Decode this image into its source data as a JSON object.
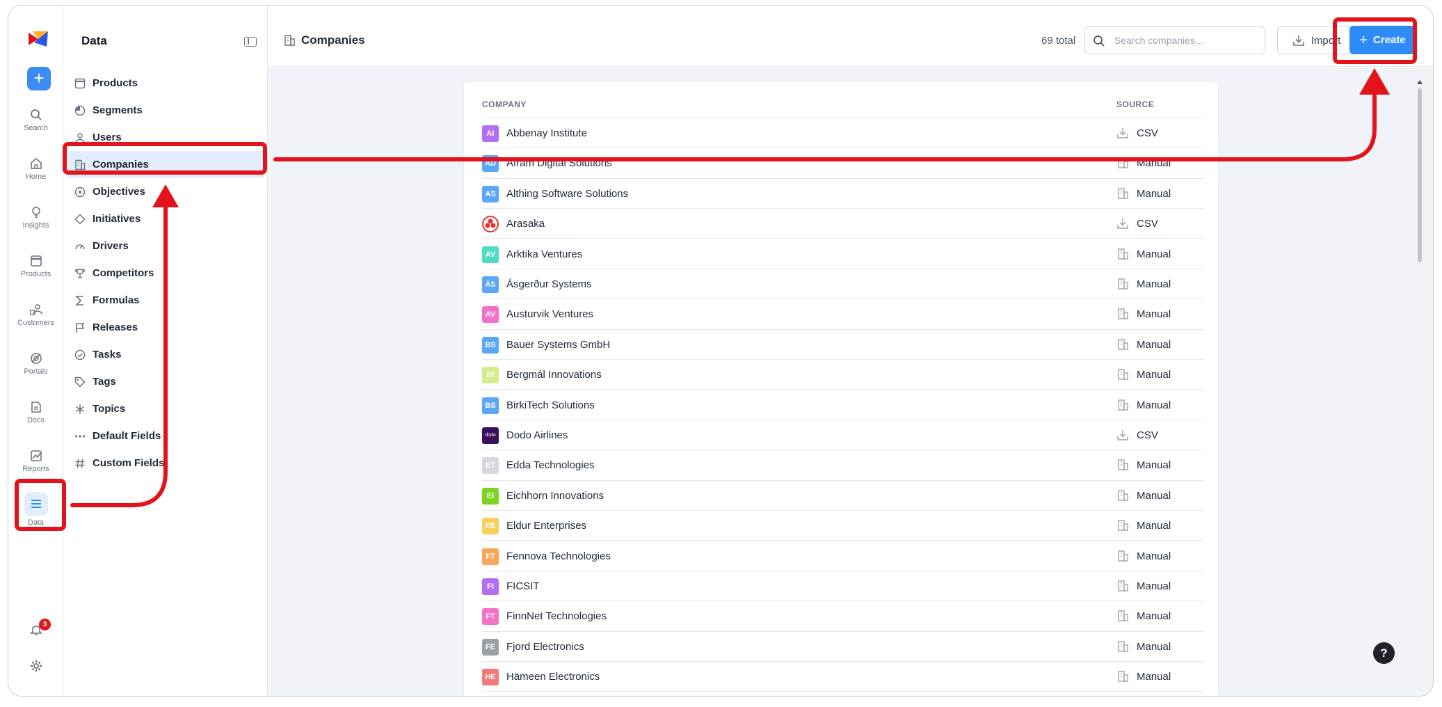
{
  "rail": {
    "items": [
      {
        "label": "Search",
        "icon": "search-icon"
      },
      {
        "label": "Home",
        "icon": "home-icon"
      },
      {
        "label": "Insights",
        "icon": "lightbulb-icon"
      },
      {
        "label": "Products",
        "icon": "products-icon"
      },
      {
        "label": "Customers",
        "icon": "customers-icon"
      },
      {
        "label": "Portals",
        "icon": "portals-icon"
      },
      {
        "label": "Docs",
        "icon": "docs-icon"
      },
      {
        "label": "Reports",
        "icon": "reports-icon"
      },
      {
        "label": "Data",
        "icon": "menu-icon"
      }
    ],
    "notifications_count": "3",
    "plus": "+"
  },
  "sidebar": {
    "title": "Data",
    "items": [
      {
        "label": "Products",
        "icon": "window-icon"
      },
      {
        "label": "Segments",
        "icon": "pie-icon"
      },
      {
        "label": "Users",
        "icon": "user-icon"
      },
      {
        "label": "Companies",
        "icon": "building-icon"
      },
      {
        "label": "Objectives",
        "icon": "target-icon"
      },
      {
        "label": "Initiatives",
        "icon": "diamond-icon"
      },
      {
        "label": "Drivers",
        "icon": "gauge-icon"
      },
      {
        "label": "Competitors",
        "icon": "trophy-icon"
      },
      {
        "label": "Formulas",
        "icon": "sigma-icon"
      },
      {
        "label": "Releases",
        "icon": "flag-icon"
      },
      {
        "label": "Tasks",
        "icon": "check-circle-icon"
      },
      {
        "label": "Tags",
        "icon": "tag-icon"
      },
      {
        "label": "Topics",
        "icon": "asterisk-icon"
      },
      {
        "label": "Default Fields",
        "icon": "dots-icon"
      },
      {
        "label": "Custom Fields",
        "icon": "hash-icon"
      }
    ]
  },
  "header": {
    "title": "Companies",
    "total": "69 total",
    "search_placeholder": "Search companies...",
    "import_label": "Import",
    "create_label": "Create"
  },
  "table": {
    "col_company": "COMPANY",
    "col_source": "SOURCE",
    "rows": [
      {
        "initials": "AI",
        "color": "#b36ff2",
        "name": "Abbenay Institute",
        "source": "CSV"
      },
      {
        "initials": "AD",
        "color": "#5aa6f8",
        "name": "Afram Digital Solutions",
        "source": "Manual"
      },
      {
        "initials": "AS",
        "color": "#5aa6f8",
        "name": "Althing Software Solutions",
        "source": "Manual"
      },
      {
        "initials": "",
        "color": "#e5322d",
        "name": "Arasaka",
        "source": "CSV"
      },
      {
        "initials": "AV",
        "color": "#4fdcc4",
        "name": "Arktika Ventures",
        "source": "Manual"
      },
      {
        "initials": "ÁS",
        "color": "#5aa6f8",
        "name": "Ásgerður Systems",
        "source": "Manual"
      },
      {
        "initials": "AV",
        "color": "#f272c8",
        "name": "Austurvik Ventures",
        "source": "Manual"
      },
      {
        "initials": "BS",
        "color": "#5aa6f8",
        "name": "Bauer Systems GmbH",
        "source": "Manual"
      },
      {
        "initials": "BI",
        "color": "#d6ec8c",
        "name": "Bergmál Innovations",
        "source": "Manual"
      },
      {
        "initials": "BS",
        "color": "#5aa6f8",
        "name": "BirkiTech Solutions",
        "source": "Manual"
      },
      {
        "initials": "dodo",
        "color": "#3a0f5c",
        "name": "Dodo Airlines",
        "source": "CSV"
      },
      {
        "initials": "ET",
        "color": "#d5d9de",
        "name": "Edda Technologies",
        "source": "Manual"
      },
      {
        "initials": "EI",
        "color": "#7ed321",
        "name": "Eichhorn Innovations",
        "source": "Manual"
      },
      {
        "initials": "EE",
        "color": "#f8cf5a",
        "name": "Eldur Enterprises",
        "source": "Manual"
      },
      {
        "initials": "FT",
        "color": "#f8a65a",
        "name": "Fennova Technologies",
        "source": "Manual"
      },
      {
        "initials": "FI",
        "color": "#b36ff2",
        "name": "FICSIT",
        "source": "Manual"
      },
      {
        "initials": "FT",
        "color": "#f272c8",
        "name": "FinnNet Technologies",
        "source": "Manual"
      },
      {
        "initials": "FE",
        "color": "#9aa0a8",
        "name": "Fjord Electronics",
        "source": "Manual"
      },
      {
        "initials": "HE",
        "color": "#f27a7a",
        "name": "Hämeen Electronics",
        "source": "Manual"
      }
    ]
  },
  "help": "?",
  "colors": {
    "accent": "#2d8cf5",
    "annotation": "#e3131b",
    "active_bg": "#e3eefc"
  }
}
